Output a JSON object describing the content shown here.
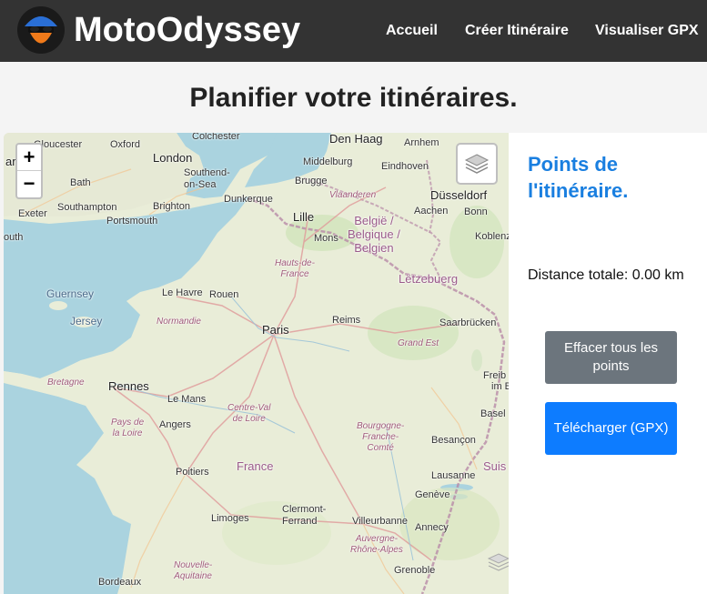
{
  "brand": {
    "name": "MotoOdyssey"
  },
  "nav": {
    "links": [
      {
        "label": "Accueil"
      },
      {
        "label": "Créer Itinéraire"
      },
      {
        "label": "Visualiser GPX"
      }
    ]
  },
  "page": {
    "title": "Planifier votre itinéraires."
  },
  "map": {
    "zoom_in": "+",
    "zoom_out": "−",
    "labels": {
      "gloucester": "Gloucester",
      "oxford": "Oxford",
      "colchester": "Colchester",
      "den_haag": "Den Haag",
      "arnhem": "Arnhem",
      "cardiff": "ardiff",
      "london": "London",
      "southend": "Southend-\non-Sea",
      "middelburg": "Middelburg",
      "eindhoven": "Eindhoven",
      "bath": "Bath",
      "brugge": "Brugge",
      "vlaanderen": "Vlaanderen",
      "dusseldorf": "Düsseldorf",
      "dunkerque": "Dunkerque",
      "southampton": "Southampton",
      "brighton": "Brighton",
      "aachen": "Aachen",
      "bonn": "Bonn",
      "exeter": "Exeter",
      "portsmouth": "Portsmouth",
      "lille": "Lille",
      "belgie": "België /\nBelgique /\nBelgien",
      "plymouth": "outh",
      "mons": "Mons",
      "koblenz": "Koblenz",
      "hauts_de_france": "Hauts-de-\nFrance",
      "letzebuerg": "Lëtzebuerg",
      "guernsey": "Guernsey",
      "le_havre": "Le Havre",
      "rouen": "Rouen",
      "jersey": "Jersey",
      "normandie": "Normandie",
      "paris": "Paris",
      "reims": "Reims",
      "saarbrucken": "Saarbrücken",
      "grand_est": "Grand Est",
      "bretagne": "Bretagne",
      "rennes": "Rennes",
      "le_mans": "Le Mans",
      "freib": "Freib",
      "im_brei": "im Brei",
      "centre": "Centre-Val\nde Loire",
      "pays_loire": "Pays de\nla Loire",
      "angers": "Angers",
      "basel": "Basel",
      "bourgogne": "Bourgogne-\nFranche-\nComté",
      "besancon": "Besançon",
      "france": "France",
      "poitiers": "Poitiers",
      "lausanne": "Lausanne",
      "suiss": "Suis",
      "geneve": "Genève",
      "clermont": "Clermont-\nFerrand",
      "limoges": "Limoges",
      "villeurbanne": "Villeurbanne",
      "annecy": "Annecy",
      "auvergne": "Auvergne-\nRhône-Alpes",
      "nouvelle_aquitaine": "Nouvelle-\nAquitaine",
      "bordeaux": "Bordeaux",
      "grenoble": "Grenoble"
    }
  },
  "panel": {
    "title": "Points de l'itinéraire.",
    "distance": "Distance totale: 0.00 km",
    "clear_button": "Effacer tous les points",
    "download_button": "Télécharger (GPX)"
  },
  "colors": {
    "navbar": "#333333",
    "accent": "#1a7fe0",
    "clear_button": "#6c757d",
    "download_button": "#0d7cff",
    "sea": "#aad3df",
    "land": "#e9edd8"
  }
}
